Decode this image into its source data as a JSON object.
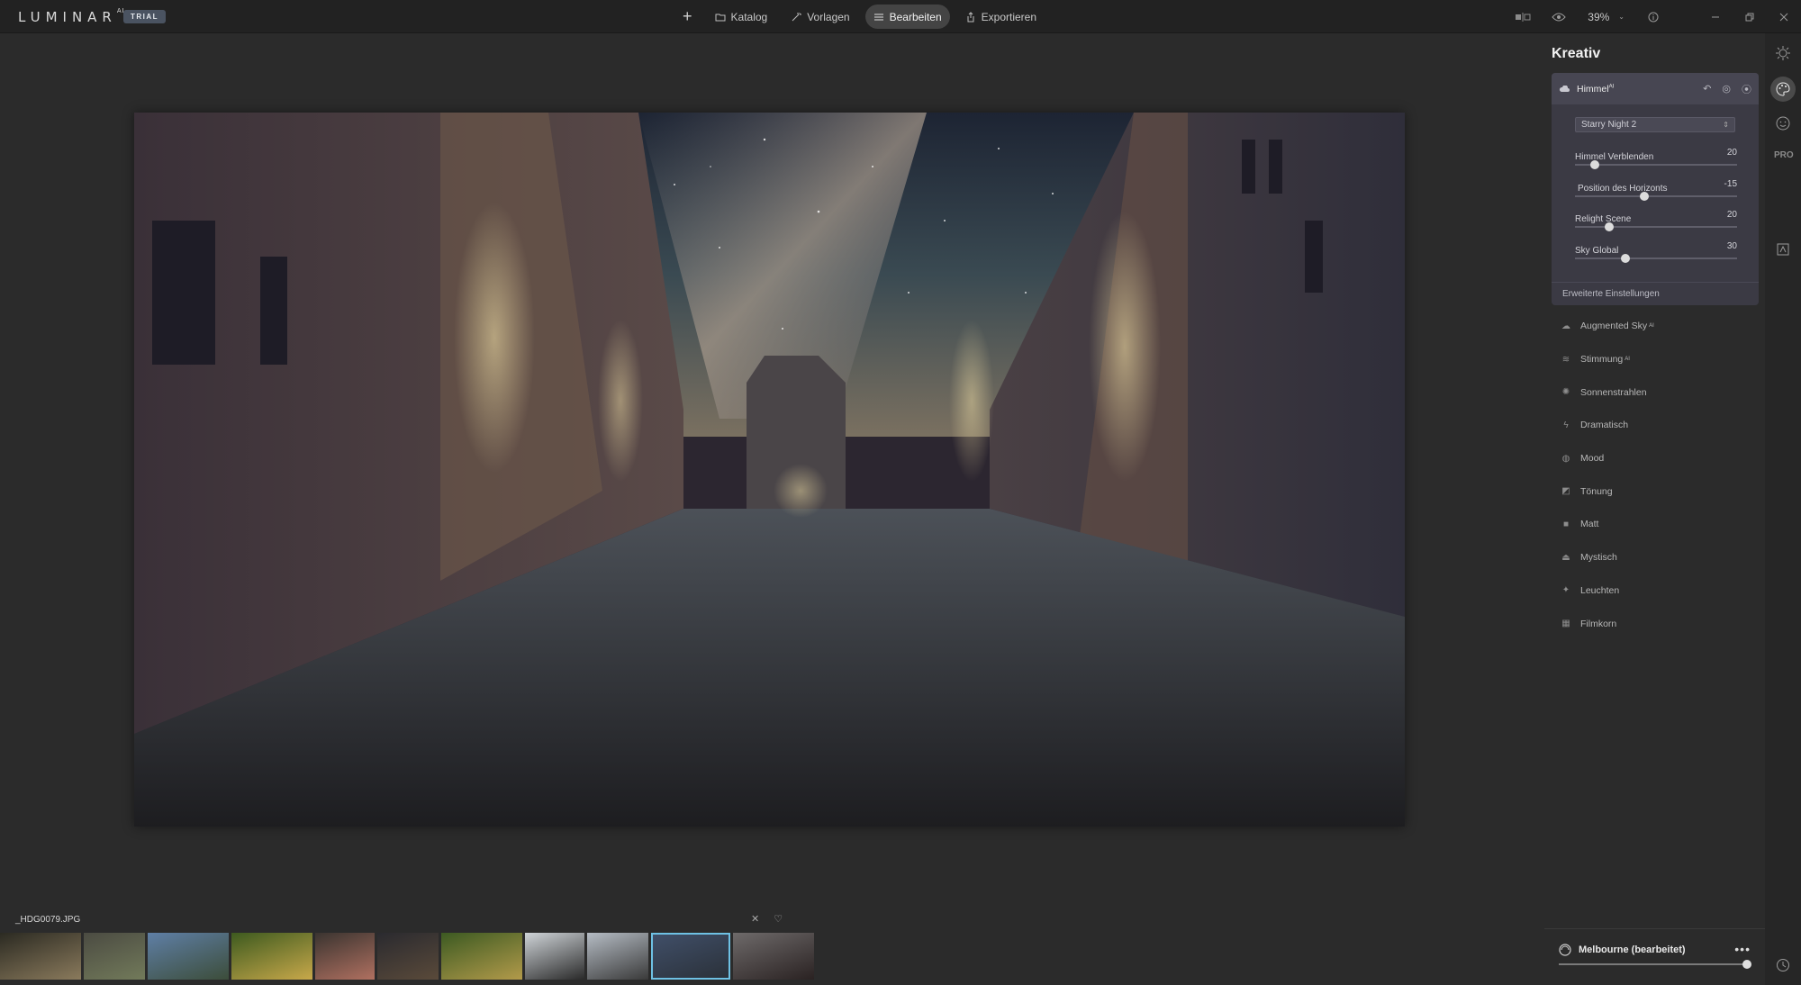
{
  "app": {
    "logo": "LUMINAR",
    "logo_sup": "AI",
    "trial_badge": "TRIAL"
  },
  "nav": {
    "add_label": "+",
    "items": [
      {
        "label": "Katalog",
        "icon": "folder-icon",
        "active": false
      },
      {
        "label": "Vorlagen",
        "icon": "wand-icon",
        "active": false
      },
      {
        "label": "Bearbeiten",
        "icon": "sliders-icon",
        "active": true
      },
      {
        "label": "Exportieren",
        "icon": "export-icon",
        "active": false
      }
    ]
  },
  "top_right": {
    "zoom_value": "39%"
  },
  "panel": {
    "title": "Kreativ",
    "sky_card": {
      "name": "Himmel",
      "name_sup": "AI",
      "selected_sky": "Starry Night 2",
      "sliders": [
        {
          "label": "Himmel Verblenden",
          "value": "20",
          "fraction": 0.12
        },
        {
          "label": "Position des Horizonts",
          "value": "-15",
          "fraction": 0.43
        },
        {
          "label": "Relight Scene",
          "value": "20",
          "fraction": 0.21
        },
        {
          "label": "Sky Global",
          "value": "30",
          "fraction": 0.31
        }
      ],
      "footer": "Erweiterte Einstellungen"
    },
    "tools": [
      {
        "label": "Augmented Sky",
        "sup": "AI",
        "icon": "cloud-icon"
      },
      {
        "label": "Stimmung",
        "sup": "AI",
        "icon": "lines-icon"
      },
      {
        "label": "Sonnenstrahlen",
        "sup": "",
        "icon": "sun-icon"
      },
      {
        "label": "Dramatisch",
        "sup": "",
        "icon": "bolt-icon"
      },
      {
        "label": "Mood",
        "sup": "",
        "icon": "globe-icon"
      },
      {
        "label": "Tönung",
        "sup": "",
        "icon": "bucket-icon"
      },
      {
        "label": "Matt",
        "sup": "",
        "icon": "square-icon"
      },
      {
        "label": "Mystisch",
        "sup": "",
        "icon": "flask-icon"
      },
      {
        "label": "Leuchten",
        "sup": "",
        "icon": "sparkle-icon"
      },
      {
        "label": "Filmkorn",
        "sup": "",
        "icon": "grain-icon"
      }
    ],
    "preset": {
      "name": "Melbourne (bearbeitet)",
      "more": "•••"
    }
  },
  "rail": {
    "pro_label": "PRO"
  },
  "filmstrip": {
    "filename": "_HDG0079.JPG",
    "thumbnails": [
      {
        "colors": [
          "#2b2a22",
          "#8a7a5c"
        ],
        "active": false
      },
      {
        "colors": [
          "#4b4b42",
          "#727a5a"
        ],
        "active": false
      },
      {
        "colors": [
          "#5f7fa6",
          "#3c4d3a"
        ],
        "active": false
      },
      {
        "colors": [
          "#3d5a1f",
          "#c8a84a"
        ],
        "active": false
      },
      {
        "colors": [
          "#3a3430",
          "#b07060"
        ],
        "active": false
      },
      {
        "colors": [
          "#2a2a2f",
          "#5a4a3a"
        ],
        "active": false
      },
      {
        "colors": [
          "#3c5a22",
          "#b29a4a"
        ],
        "active": false
      },
      {
        "colors": [
          "#cfd4d8",
          "#2a2a2a"
        ],
        "active": false
      },
      {
        "colors": [
          "#b5bcc4",
          "#3a3a3a"
        ],
        "active": false
      },
      {
        "colors": [
          "#41506a",
          "#2a3038"
        ],
        "active": true
      },
      {
        "colors": [
          "#6e6a6a",
          "#2a2222"
        ],
        "active": false
      }
    ]
  },
  "colors": {
    "accent": "#6ec1e4",
    "bg": "#2b2b2b",
    "card": "#3b3a44"
  }
}
